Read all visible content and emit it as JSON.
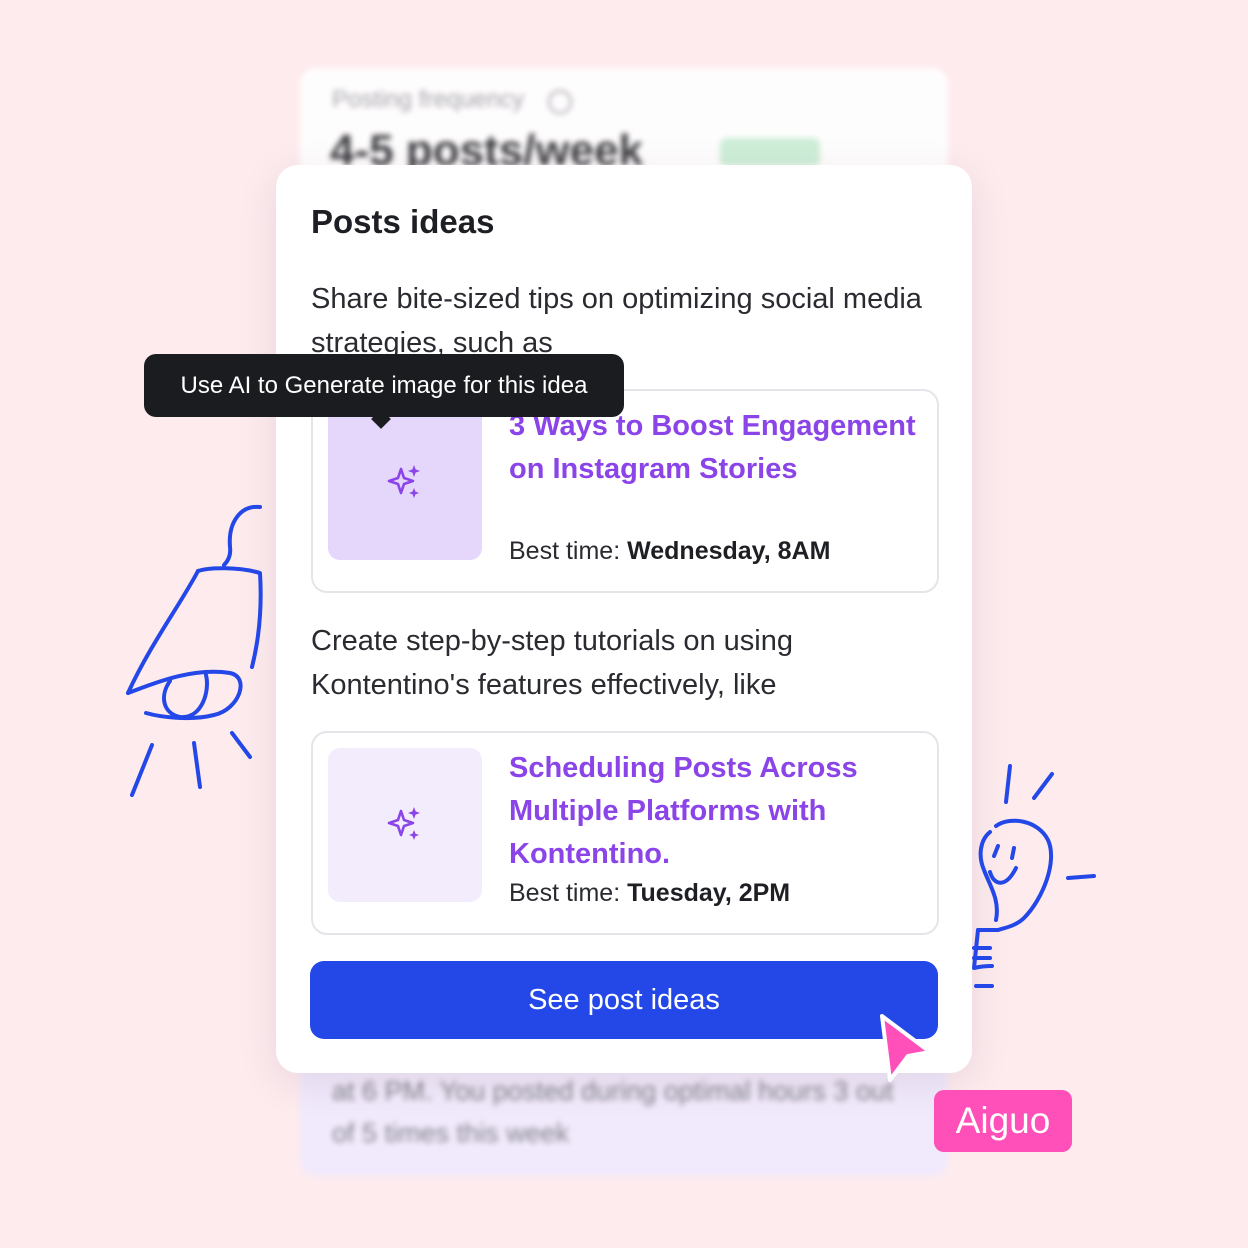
{
  "background_card_top": {
    "label": "Posting frequency",
    "value": "4-5 posts/week"
  },
  "background_card_bottom": {
    "text": "at 6 PM. You posted during optimal hours 3 out of 5 times this week"
  },
  "card": {
    "title": "Posts ideas",
    "ideas": [
      {
        "description": "Share bite-sized tips on optimizing social media strategies, such as",
        "title": "3 Ways to Boost Engagement on Instagram Stories",
        "best_time_label": "Best time:",
        "best_time_value": "Wednesday, 8AM",
        "thumb_icon": "sparkles-icon"
      },
      {
        "description": "Create step-by-step tutorials on using Kontentino's features effectively, like",
        "title": "Scheduling Posts Across Multiple Platforms with Kontentino.",
        "best_time_label": "Best time:",
        "best_time_value": "Tuesday, 2PM",
        "thumb_icon": "sparkles-icon"
      }
    ],
    "cta_label": "See post ideas"
  },
  "tooltip": {
    "text": "Use AI to Generate image for this idea"
  },
  "cursor_user": {
    "name": "Aiguo"
  },
  "colors": {
    "page_background": "#fdebee",
    "accent_purple": "#8a44e8",
    "button_blue": "#2447e8",
    "cursor_pink": "#ff4fb8",
    "doodle_blue": "#2447e8"
  }
}
